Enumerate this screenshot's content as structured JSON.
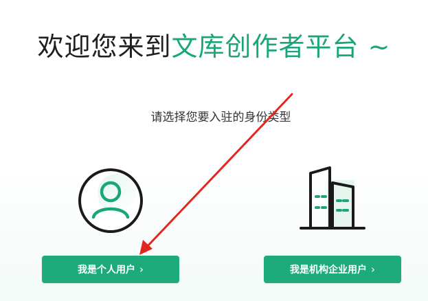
{
  "header": {
    "title_part1": "欢迎您来到",
    "title_part2": "文库创作者平台",
    "title_tilde": " ~",
    "subtitle": "请选择您要入驻的身份类型"
  },
  "options": [
    {
      "label": "我是个人用户",
      "chevron": "›",
      "icon": "user-icon"
    },
    {
      "label": "我是机构企业用户",
      "chevron": "›",
      "icon": "building-icon"
    }
  ],
  "colors": {
    "accent": "#1eab7c",
    "title_green": "#1aa57a",
    "arrow": "#e5251f"
  }
}
